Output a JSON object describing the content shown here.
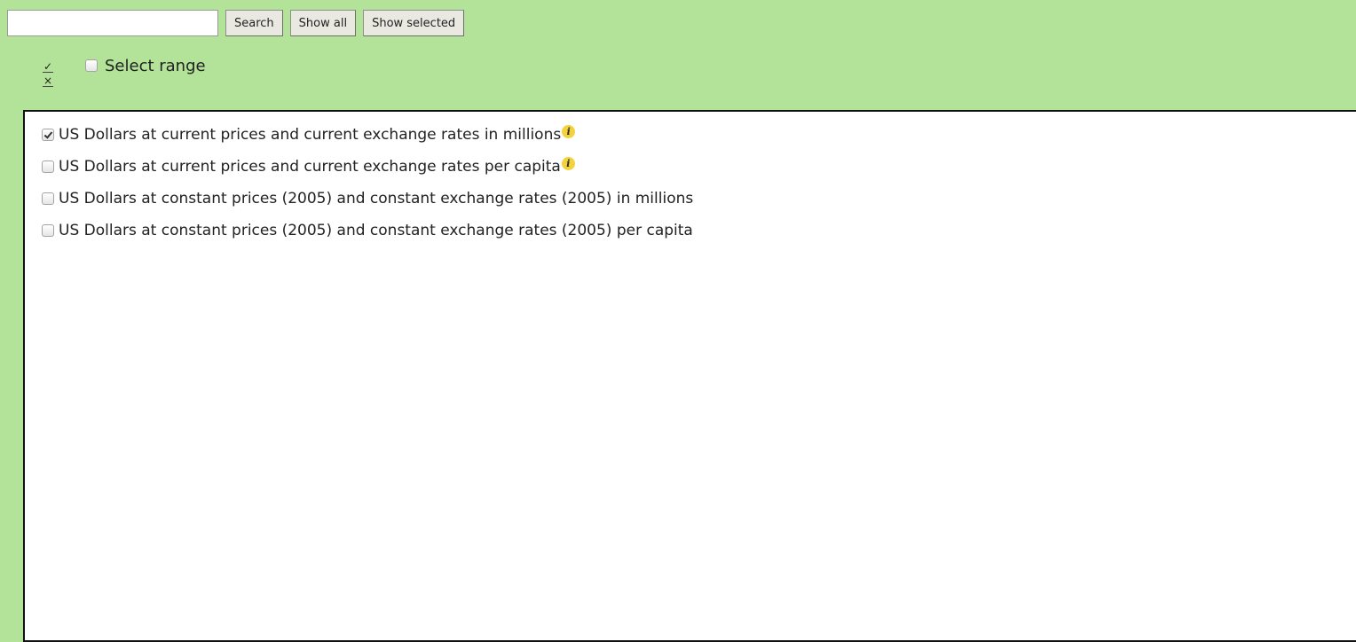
{
  "toolbar": {
    "search_value": "",
    "search_label": "Search",
    "show_all_label": "Show all",
    "show_selected_label": "Show selected"
  },
  "selection_controls": {
    "check_all_glyph": "✓",
    "clear_all_glyph": "×"
  },
  "select_range": {
    "label": "Select range",
    "checked": false
  },
  "measures": [
    {
      "label": "US Dollars at current prices and current exchange rates in millions",
      "checked": true,
      "has_info": true
    },
    {
      "label": "US Dollars at current prices and current exchange rates per capita",
      "checked": false,
      "has_info": true
    },
    {
      "label": "US Dollars at constant prices (2005) and constant exchange rates (2005) in millions",
      "checked": false,
      "has_info": false
    },
    {
      "label": "US Dollars at constant prices (2005) and constant exchange rates (2005) per capita",
      "checked": false,
      "has_info": false
    }
  ],
  "icons": {
    "info": "info-icon",
    "info_glyph": "i"
  },
  "colors": {
    "background": "#b2e399",
    "panel": "#ffffff",
    "panel_border": "#111111",
    "info_badge": "#f4d23c"
  }
}
